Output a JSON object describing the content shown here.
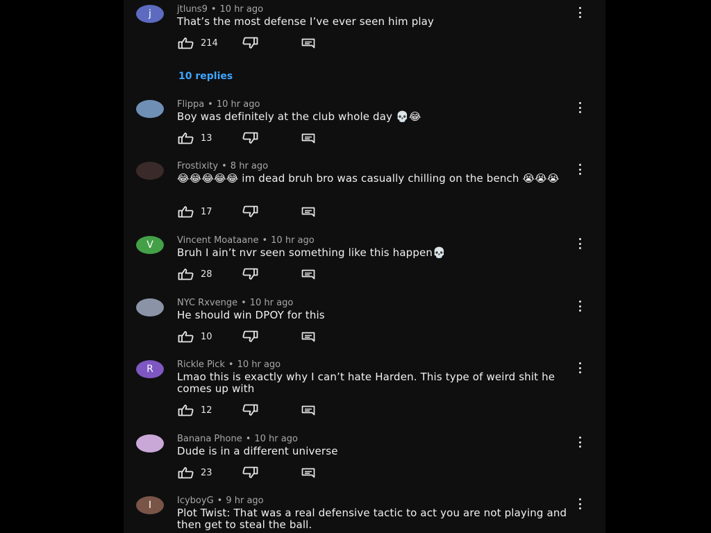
{
  "colors": {
    "background": "#0f0f0f",
    "text": "#f1f1f1",
    "meta": "#a8a8a8",
    "link": "#3ea6ff"
  },
  "icons": {
    "like": "thumb-up-icon",
    "dislike": "thumb-down-icon",
    "reply": "comment-icon",
    "more": "kebab-menu-icon"
  },
  "comments": [
    {
      "initial": "j",
      "avatar_color": "#5c6bc0",
      "author": "jtluns9",
      "separator": "•",
      "time": "10 hr ago",
      "text": "That’s the most defense I’ve ever seen him play",
      "likes": "214",
      "replies_label": "10 replies"
    },
    {
      "initial": "",
      "avatar_color": "#6f8fb5",
      "author": "Flippa",
      "separator": "•",
      "time": "10 hr ago",
      "text": "Boy was definitely at the club whole day 💀😂",
      "likes": "13"
    },
    {
      "initial": "",
      "avatar_color": "#3a2a2a",
      "author": "Frostixity",
      "separator": "•",
      "time": "8 hr ago",
      "text": "😂😂😂😂😂 im dead bruh bro was casually chilling on the bench 😭😭😭",
      "likes": "17"
    },
    {
      "initial": "V",
      "avatar_color": "#43a047",
      "author": "Vincent Moataane",
      "separator": "•",
      "time": "10 hr ago",
      "text": "Bruh I ain’t nvr seen something like this happen💀",
      "likes": "28"
    },
    {
      "initial": "",
      "avatar_color": "#8a94a6",
      "author": "NYC Rxvenge",
      "separator": "•",
      "time": "10 hr ago",
      "text": "He should win DPOY for this",
      "likes": "10"
    },
    {
      "initial": "R",
      "avatar_color": "#7e57c2",
      "author": "Rickle Pick",
      "separator": "•",
      "time": "10 hr ago",
      "text": "Lmao this is exactly why I can’t hate Harden. This type of weird shit he comes up with",
      "likes": "12"
    },
    {
      "initial": "",
      "avatar_color": "#c9a8d8",
      "author": "Banana Phone",
      "separator": "•",
      "time": "10 hr ago",
      "text": "Dude is in a different universe",
      "likes": "23"
    },
    {
      "initial": "I",
      "avatar_color": "#795548",
      "author": "IcyboyG",
      "separator": "•",
      "time": "9 hr ago",
      "text": "Plot Twist: That was a real defensive tactic to act you are not playing and then get to steal the ball."
    }
  ]
}
